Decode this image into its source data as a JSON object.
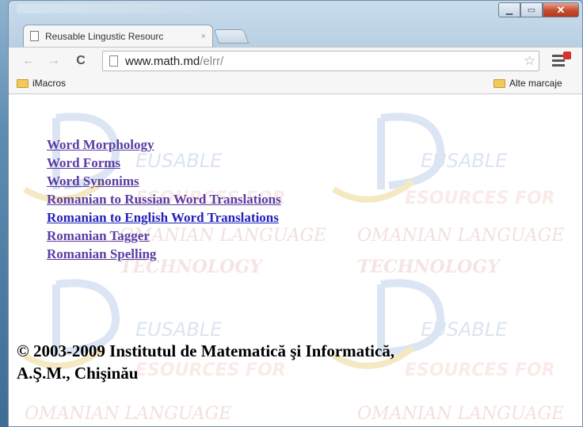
{
  "browser": {
    "tab_title": "Reusable Lingustic Resourc",
    "tab_close": "×",
    "url_host": "www.math.md",
    "url_path": "/elrr/",
    "nav_back": "←",
    "nav_forward": "→",
    "nav_reload": "C",
    "star": "☆",
    "window_min": "▁",
    "window_max": "▭",
    "window_close": "✕"
  },
  "bookmarks": {
    "left_folder": "iMacros",
    "right_folder": "Alte marcaje"
  },
  "links": [
    {
      "label": "Word Morphology"
    },
    {
      "label": "Word Forms"
    },
    {
      "label": "Word Synonims"
    },
    {
      "label": "Romanian to Russian Word Translations"
    },
    {
      "label": "Romanian to English Word Translations"
    },
    {
      "label": "Romanian Tagger"
    },
    {
      "label": "Romanian Spelling"
    }
  ],
  "footer": {
    "line1": "© 2003-2009 Institutul de Matematică şi Informatică,",
    "line2": "A.Ş.M., Chişinău"
  },
  "watermark": {
    "word1": "EUSABLE",
    "word2": "ESOURCES FOR",
    "word3": "OMANIAN LANGUAGE",
    "word4": "TECHNOLOGY"
  }
}
